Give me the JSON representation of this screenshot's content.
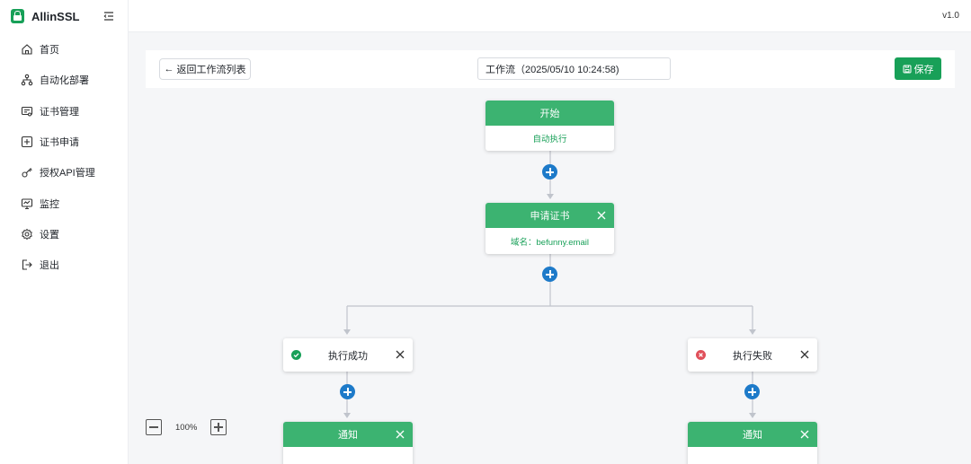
{
  "app": {
    "name": "AllinSSL",
    "version": "v1.0"
  },
  "sidebar": {
    "items": [
      {
        "label": "首页",
        "icon": "home-icon"
      },
      {
        "label": "自动化部署",
        "icon": "workflow-icon"
      },
      {
        "label": "证书管理",
        "icon": "certificate-icon"
      },
      {
        "label": "证书申请",
        "icon": "plus-square-icon"
      },
      {
        "label": "授权API管理",
        "icon": "api-key-icon"
      },
      {
        "label": "监控",
        "icon": "monitor-icon"
      },
      {
        "label": "设置",
        "icon": "gear-icon"
      },
      {
        "label": "退出",
        "icon": "logout-icon"
      }
    ]
  },
  "editor": {
    "back_label": "返回工作流列表",
    "workflow_name": "工作流（2025/05/10 10:24:58)",
    "save_label": "保存",
    "zoom": "100%"
  },
  "nodes": {
    "start": {
      "title": "开始",
      "body": "自动执行"
    },
    "apply": {
      "title": "申请证书",
      "body": "域名：befunny.email"
    },
    "success": {
      "title": "执行成功"
    },
    "fail": {
      "title": "执行失败"
    },
    "notify_left": {
      "title": "通知"
    },
    "notify_right": {
      "title": "通知"
    }
  },
  "colors": {
    "accent": "#18a058",
    "node_header": "#3cb371",
    "add_button": "#1d7ac9",
    "error": "#e0505a"
  }
}
